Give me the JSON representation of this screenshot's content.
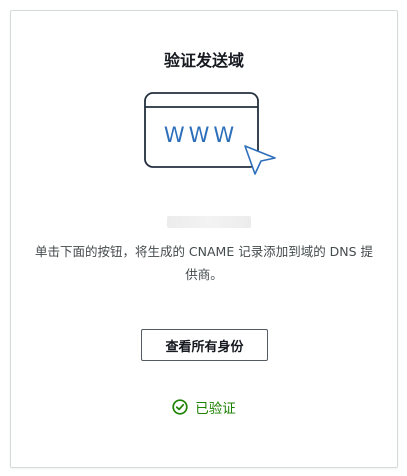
{
  "panel": {
    "title": "验证发送域",
    "illustration": {
      "text": "WWW",
      "icon": "browser-window-with-cursor-icon",
      "accent_color": "#2e6fbb"
    },
    "description": "单击下面的按钮，将生成的 CNAME 记录添加到域的 DNS 提供商。",
    "button_label": "查看所有身份",
    "status": {
      "label": "已验证",
      "icon": "check-circle-icon",
      "color": "#1d8102"
    }
  }
}
